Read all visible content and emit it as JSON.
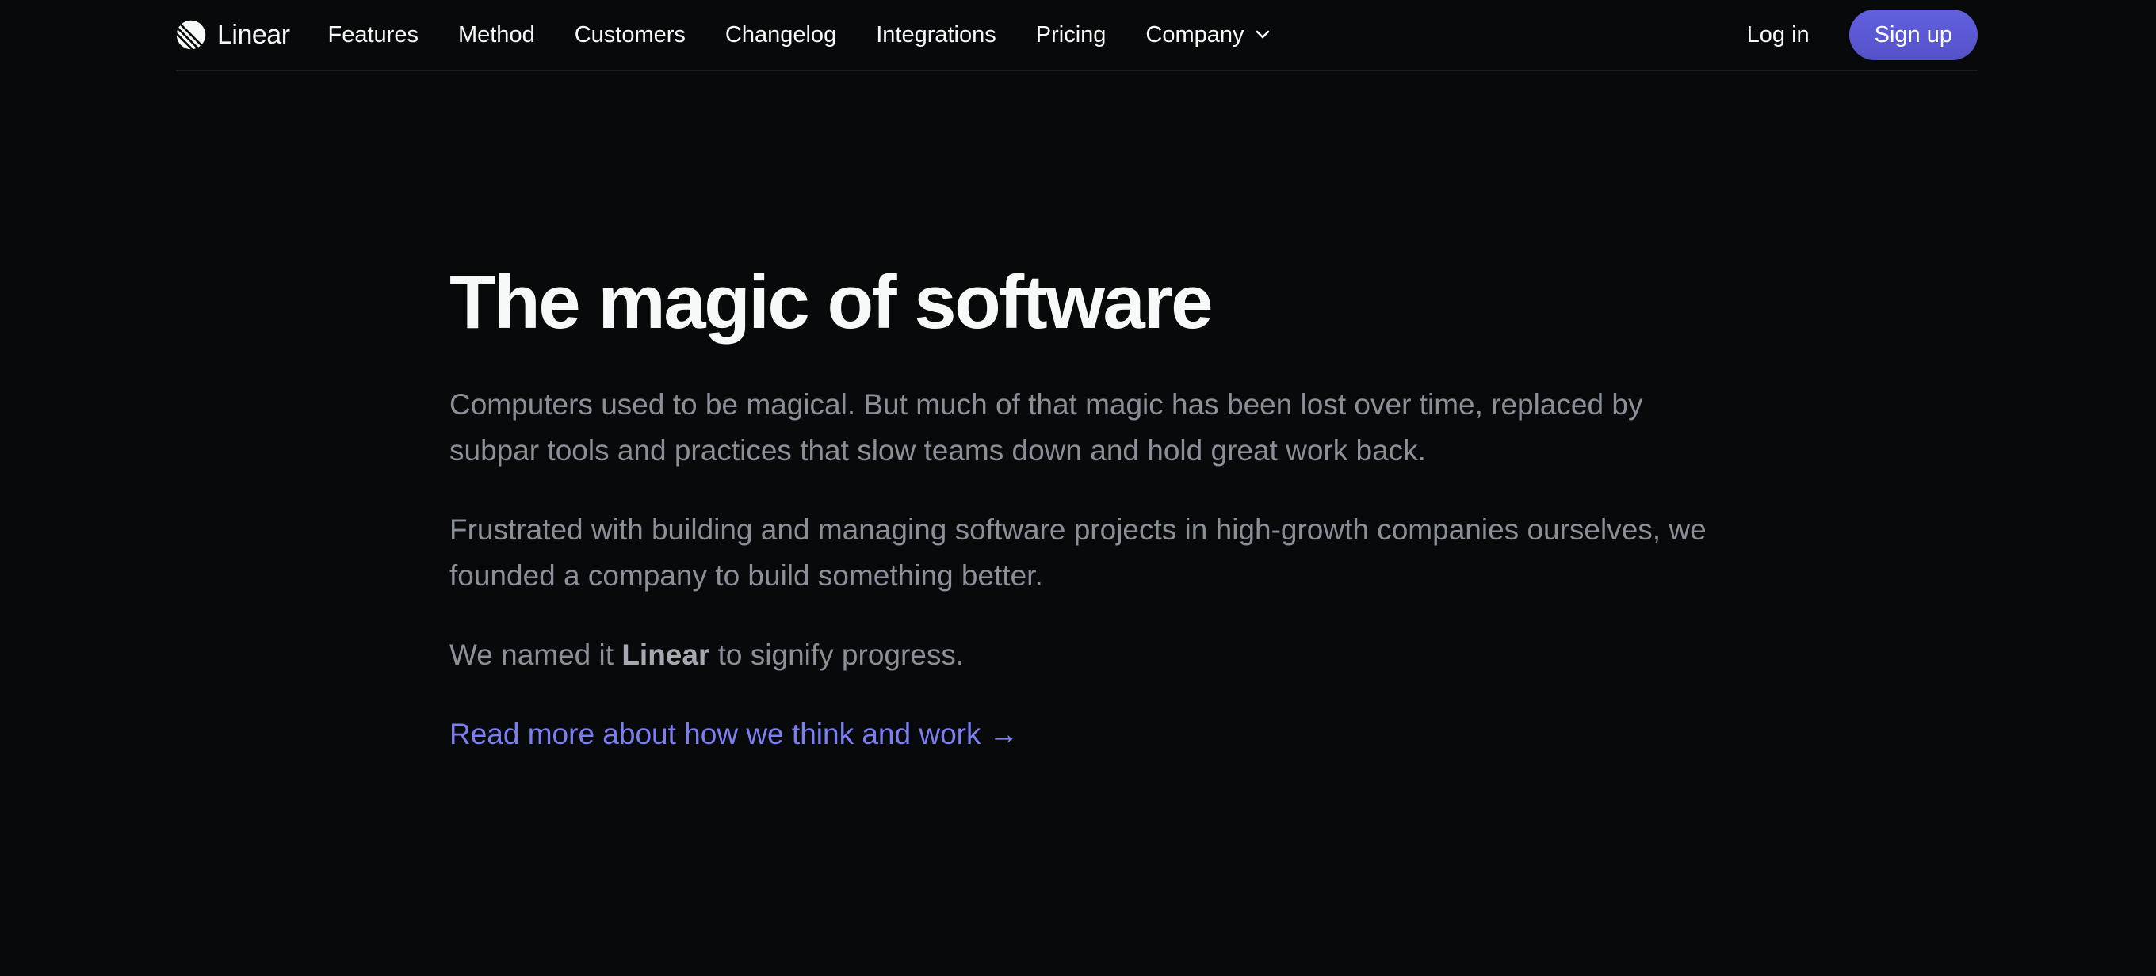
{
  "nav": {
    "brand": "Linear",
    "links": [
      "Features",
      "Method",
      "Customers",
      "Changelog",
      "Integrations",
      "Pricing",
      "Company"
    ],
    "login": "Log in",
    "signup": "Sign up"
  },
  "hero": {
    "title": "The magic of software",
    "para1": "Computers used to be magical. But much of that magic has been lost over time, replaced by subpar tools and practices that slow teams down and hold great work back.",
    "para2": "Frustrated with building and managing software projects in high-growth companies ourselves, we founded a company to build something better.",
    "para3_before": "We named it ",
    "para3_bold": "Linear",
    "para3_after": " to signify progress.",
    "more_link": "Read more about how we think and work →"
  },
  "colors": {
    "background": "#08090a",
    "accent": "#5e5cd6",
    "link": "#7c7ff0",
    "muted_text": "#8a8f98"
  },
  "icons": {
    "brand": "linear-logo-icon",
    "company_menu": "chevron-down-icon"
  }
}
